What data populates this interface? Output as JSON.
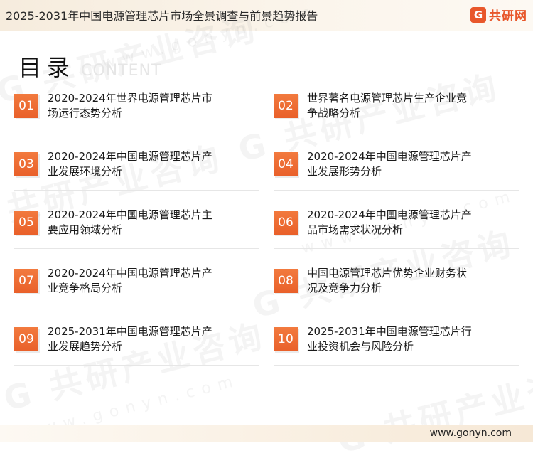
{
  "header": {
    "title": "2025-2031年中国电源管理芯片市场全景调查与前景趋势报告",
    "logo_mark": "G",
    "logo_text": "共研网"
  },
  "toc": {
    "title": "目录",
    "subtitle": "CONTENT"
  },
  "items": [
    {
      "num": "01",
      "line1": "2020-2024年世界电源管理芯片市",
      "line2": "场运行态势分析"
    },
    {
      "num": "02",
      "line1": "世界著名电源管理芯片生产企业竞",
      "line2": "争战略分析"
    },
    {
      "num": "03",
      "line1": "2020-2024年中国电源管理芯片产",
      "line2": "业发展环境分析"
    },
    {
      "num": "04",
      "line1": "2020-2024年中国电源管理芯片产",
      "line2": "业发展形势分析"
    },
    {
      "num": "05",
      "line1": "2020-2024年中国电源管理芯片主",
      "line2": "要应用领域分析"
    },
    {
      "num": "06",
      "line1": "2020-2024年中国电源管理芯片产",
      "line2": "品市场需求状况分析"
    },
    {
      "num": "07",
      "line1": "2020-2024年中国电源管理芯片产",
      "line2": "业竞争格局分析"
    },
    {
      "num": "08",
      "line1": "中国电源管理芯片优势企业财务状",
      "line2": "况及竞争力分析"
    },
    {
      "num": "09",
      "line1": "2025-2031年中国电源管理芯片产",
      "line2": "业发展趋势分析"
    },
    {
      "num": "10",
      "line1": "2025-2031年中国电源管理芯片行",
      "line2": "业投资机会与风险分析"
    }
  ],
  "watermark": {
    "brand": "G 共研产业咨询",
    "url": "www.gonyn.com"
  },
  "footer": {
    "url": "www.gonyn.com"
  }
}
